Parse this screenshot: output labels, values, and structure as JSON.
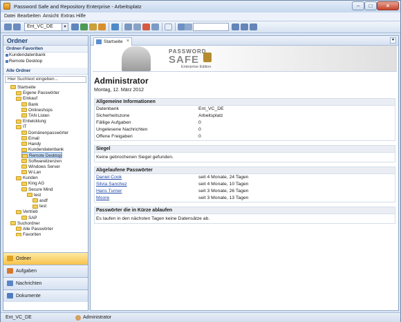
{
  "window": {
    "title": "Password Safe and Repository Enterprise - Arbeitsplatz"
  },
  "menu": [
    "Datei",
    "Bearbeiten",
    "Ansicht",
    "Extras",
    "Hilfe"
  ],
  "toolbar": {
    "combo_value": "Ent_VC_DE",
    "search_value": ""
  },
  "left": {
    "title": "Ordner",
    "favorites_title": "Ordner-Favoriten",
    "favorites": [
      "Kundendatenbank",
      "Remote Desktop"
    ],
    "all_folders_title": "Alle Ordner",
    "search_placeholder": "Hier Suchtext eingeben...",
    "tree": [
      {
        "label": "Startseite",
        "depth": 0
      },
      {
        "label": "Eigene Passwörter",
        "depth": 1
      },
      {
        "label": "Einkauf",
        "depth": 1
      },
      {
        "label": "Bank",
        "depth": 2
      },
      {
        "label": "Onlineshops",
        "depth": 2
      },
      {
        "label": "TAN Listen",
        "depth": 2
      },
      {
        "label": "Entwicklung",
        "depth": 1
      },
      {
        "label": "IT",
        "depth": 1
      },
      {
        "label": "Domänenpasswörter",
        "depth": 2
      },
      {
        "label": "Email",
        "depth": 2
      },
      {
        "label": "Handy",
        "depth": 2
      },
      {
        "label": "Kundendatenbank",
        "depth": 2
      },
      {
        "label": "Remote Desktop",
        "depth": 2,
        "selected": true
      },
      {
        "label": "Softwarelizenzen",
        "depth": 2
      },
      {
        "label": "Windows Server",
        "depth": 2
      },
      {
        "label": "W-Lan",
        "depth": 2
      },
      {
        "label": "Kunden",
        "depth": 1
      },
      {
        "label": "King AG",
        "depth": 2
      },
      {
        "label": "Secure Mind",
        "depth": 2
      },
      {
        "label": "test",
        "depth": 3
      },
      {
        "label": "asdf",
        "depth": 4
      },
      {
        "label": "test",
        "depth": 4
      },
      {
        "label": "Vertrieb",
        "depth": 1
      },
      {
        "label": "SAP",
        "depth": 2
      },
      {
        "label": "Suchordner",
        "depth": 0
      },
      {
        "label": "Alle Passwörter",
        "depth": 1
      },
      {
        "label": "Favoriten",
        "depth": 1
      }
    ],
    "nav": [
      {
        "label": "Ordner",
        "active": true,
        "color": "#e0a020"
      },
      {
        "label": "Aufgaben",
        "active": false,
        "color": "#d7782b"
      },
      {
        "label": "Nachrichten",
        "active": false,
        "color": "#5a86c6"
      },
      {
        "label": "Dokumente",
        "active": false,
        "color": "#4f7dbf"
      }
    ]
  },
  "tab": {
    "label": "Startseite",
    "close": "×",
    "dropdown": "▾"
  },
  "banner": {
    "line1": "PASSWORD",
    "line2": "SAFE",
    "line3": "Enterprise Edition"
  },
  "main": {
    "user": "Administrator",
    "date": "Montag, 12. März 2012",
    "general": {
      "title": "Allgemeine Informationen",
      "rows": [
        {
          "label": "Datenbank",
          "value": "Ent_VC_DE"
        },
        {
          "label": "Sicherheitszone",
          "value": "Arbeitsplatz"
        },
        {
          "label": "Fällige Aufgaben",
          "value": "0"
        },
        {
          "label": "Ungelesene Nachrichten",
          "value": "0"
        },
        {
          "label": "Offene Freigaben",
          "value": "0"
        }
      ]
    },
    "seal": {
      "title": "Siegel",
      "text": "Keine gebrochenen Siegel gefunden."
    },
    "expired": {
      "title": "Abgelaufene Passwörter",
      "rows": [
        {
          "label": "Daniel Cook",
          "value": "seit 4 Monate, 24 Tagen"
        },
        {
          "label": "Silvia Sanchez",
          "value": "seit 4 Monate, 10 Tagen"
        },
        {
          "label": "Hans Turner",
          "value": "seit 3 Monate, 26 Tagen"
        },
        {
          "label": "Moore",
          "value": "seit 3 Monate, 13 Tagen"
        }
      ]
    },
    "soon": {
      "title": "Passwörter die in Kürze ablaufen",
      "text": "Es laufen in den nächsten Tagen keine Datensätze ab."
    }
  },
  "status": {
    "database": "Ent_VC_DE",
    "user": "Administrator"
  }
}
